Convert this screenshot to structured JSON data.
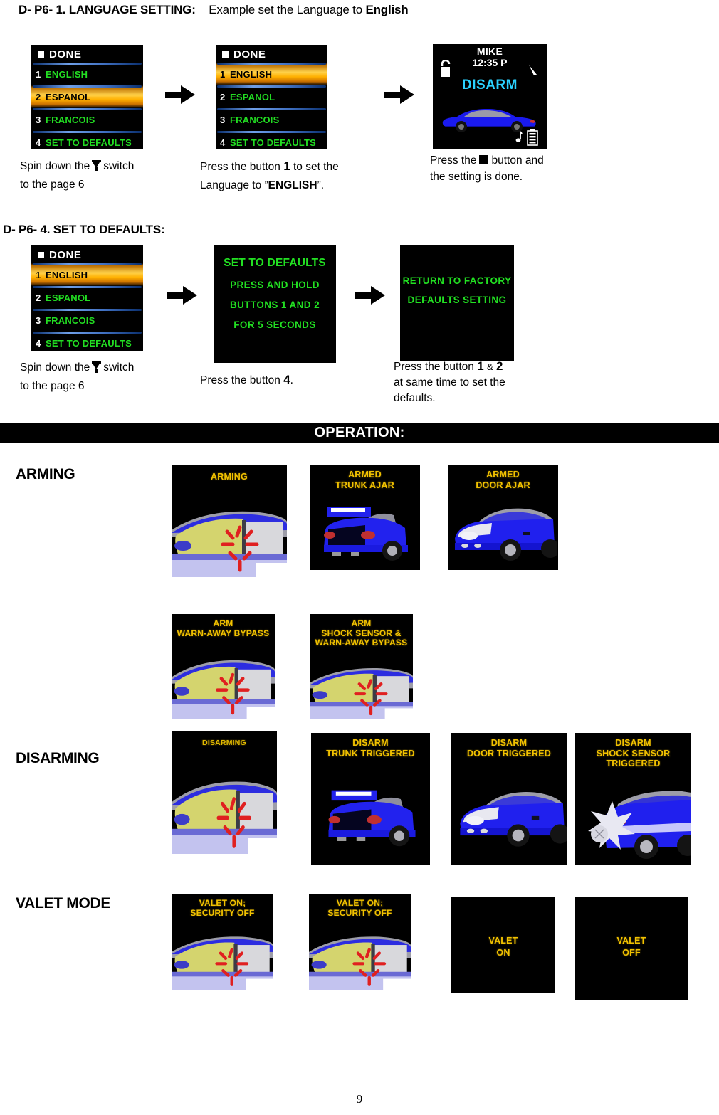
{
  "sections": {
    "language": {
      "heading_prefix": "D- P6- 1. LANGUAGE SETTING:",
      "heading_rest": "Example set the Language to ",
      "heading_bold": "English",
      "menu_before": {
        "header": "DONE",
        "items": [
          {
            "num": "1",
            "label": "ENGLISH",
            "highlighted": false
          },
          {
            "num": "2",
            "label": "ESPANOL",
            "highlighted": true
          },
          {
            "num": "3",
            "label": "FRANCOIS",
            "highlighted": false
          },
          {
            "num": "4",
            "label": "SET TO DEFAULTS",
            "highlighted": false
          }
        ]
      },
      "menu_after": {
        "header": "DONE",
        "items": [
          {
            "num": "1",
            "label": "ENGLISH",
            "highlighted": true
          },
          {
            "num": "2",
            "label": "ESPANOL",
            "highlighted": false
          },
          {
            "num": "3",
            "label": "FRANCOIS",
            "highlighted": false
          },
          {
            "num": "4",
            "label": "SET TO DEFAULTS",
            "highlighted": false
          }
        ]
      },
      "status_screen": {
        "name": "MIKE",
        "time": "12:35 P",
        "mode": "DISARM"
      },
      "caption1_a": "Spin down the",
      "caption1_b": "switch",
      "caption1_c": "to the page 6",
      "caption2_a": "Press the button",
      "caption2_num": "1",
      "caption2_b": "to set the",
      "caption2_c": "Language to ”",
      "caption2_bold": "ENGLISH",
      "caption2_d": "”.",
      "caption3_a": "Press the",
      "caption3_b": "button and",
      "caption3_c": "the setting is done."
    },
    "defaults": {
      "heading": "D- P6- 4. SET TO DEFAULTS:",
      "menu": {
        "header": "DONE",
        "items": [
          {
            "num": "1",
            "label": "ENGLISH",
            "highlighted": true
          },
          {
            "num": "2",
            "label": "ESPANOL",
            "highlighted": false
          },
          {
            "num": "3",
            "label": "FRANCOIS",
            "highlighted": false
          },
          {
            "num": "4",
            "label": "SET TO DEFAULTS",
            "highlighted": false
          }
        ]
      },
      "prompt_screen": {
        "line1": "SET TO DEFAULTS",
        "line2": "PRESS AND HOLD",
        "line3": "BUTTONS 1 AND 2",
        "line4": "FOR 5 SECONDS"
      },
      "confirm_screen": {
        "line1": "RETURN TO FACTORY",
        "line2": "DEFAULTS SETTING"
      },
      "caption1_a": "Spin down the",
      "caption1_b": "switch",
      "caption1_c": "to the page 6",
      "caption2_a": "Press the button",
      "caption2_num": "4",
      "caption2_b": ".",
      "caption3_a": "Press the button",
      "caption3_n1": "1",
      "caption3_amp": "&",
      "caption3_n2": "2",
      "caption3_b": "at same time to set the",
      "caption3_c": "defaults."
    }
  },
  "operation": {
    "banner": "OPERATION:",
    "rows": [
      {
        "label": "ARMING",
        "screens": [
          {
            "title": "ARMING",
            "art": "window-flash"
          },
          {
            "title": "ARMED\nTRUNK AJAR",
            "art": "car-trunk"
          },
          {
            "title": "ARMED\nDOOR AJAR",
            "art": "car-front"
          }
        ]
      },
      {
        "label": "",
        "screens": [
          {
            "title": "ARM\nWARN-AWAY BYPASS",
            "art": "window-flash"
          },
          {
            "title": "ARM\nSHOCK SENSOR  &\nWARN-AWAY BYPASS",
            "art": "window-flash"
          }
        ]
      },
      {
        "label": "DISARMING",
        "screens": [
          {
            "title": "DISARMING",
            "art": "window-flash"
          },
          {
            "title": "DISARM\nTRUNK TRIGGERED",
            "art": "car-trunk"
          },
          {
            "title": "DISARM\nDOOR TRIGGERED",
            "art": "car-front"
          },
          {
            "title": "DISARM\nSHOCK SENSOR\nTRIGGERED",
            "art": "car-shock"
          }
        ]
      },
      {
        "label": "VALET MODE",
        "screens": [
          {
            "title": "VALET ON;\nSECURITY OFF",
            "art": "window-flash"
          },
          {
            "title": "VALET ON;\nSECURITY OFF",
            "art": "window-flash"
          },
          {
            "title": "VALET\nON",
            "art": "none"
          },
          {
            "title": "VALET\nOFF",
            "art": "none"
          }
        ]
      }
    ],
    "labels": {
      "arming": "ARMING",
      "disarming": "DISARMING",
      "valet": "VALET MODE"
    },
    "titles": {
      "arming": "ARMING",
      "armed_trunk_1": "ARMED",
      "armed_trunk_2": "TRUNK AJAR",
      "armed_door_1": "ARMED",
      "armed_door_2": "DOOR AJAR",
      "arm_bypass_1": "ARM",
      "arm_bypass_2": "WARN-AWAY BYPASS",
      "arm_shock_1": "ARM",
      "arm_shock_2": "SHOCK SENSOR  &",
      "arm_shock_3": "WARN-AWAY BYPASS",
      "disarming": "DISARMING",
      "dis_trunk_1": "DISARM",
      "dis_trunk_2": "TRUNK TRIGGERED",
      "dis_door_1": "DISARM",
      "dis_door_2": "DOOR TRIGGERED",
      "dis_shock_1": "DISARM",
      "dis_shock_2": "SHOCK SENSOR",
      "dis_shock_3": "TRIGGERED",
      "valet_on_1": "VALET ON;",
      "valet_on_2": "SECURITY OFF",
      "valet_on_3": "VALET ON;",
      "valet_on_4": "SECURITY OFF",
      "valet_txt_on_1": "VALET",
      "valet_txt_on_2": "ON",
      "valet_txt_off_1": "VALET",
      "valet_txt_off_2": "OFF"
    }
  },
  "footer": {
    "page_number": "9"
  },
  "colors": {
    "lcd_background": "#000000",
    "menu_green": "#22dd22",
    "menu_highlight": "#ffb000",
    "status_cyan": "#2ad2ff",
    "operation_yellow": "#f2c200",
    "divider_blue": "#3f6fc0",
    "car_blue": "#1a1aee"
  }
}
